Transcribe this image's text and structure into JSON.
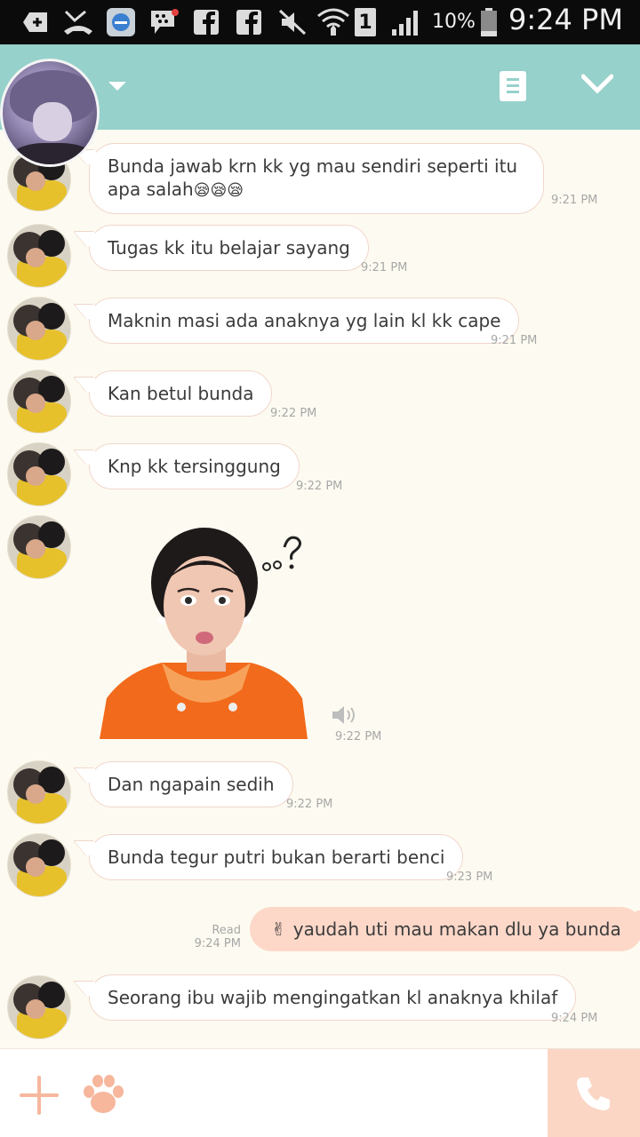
{
  "status_bar": {
    "battery_percent": "10%",
    "time": "9:24 PM",
    "sim_slot": "1",
    "icons": [
      "add-box-icon",
      "missed-call-icon",
      "app-icon",
      "bbm-icon",
      "facebook-icon",
      "facebook-icon",
      "mute-icon",
      "wifi-icon",
      "signal-icon",
      "battery-icon"
    ]
  },
  "header": {
    "background": "#96d1cb",
    "icons": [
      "dropdown-caret-icon",
      "notes-icon",
      "chevron-down-icon"
    ]
  },
  "messages": [
    {
      "type": "received",
      "text": "Bunda jawab krn kk yg mau sendiri seperti itu apa salah",
      "emoji": "😪😪😪",
      "time": "9:21 PM"
    },
    {
      "type": "received",
      "text": "Tugas kk itu belajar sayang",
      "time": "9:21 PM"
    },
    {
      "type": "received",
      "text": "Maknin masi ada anaknya yg lain kl kk cape",
      "time": "9:21 PM"
    },
    {
      "type": "received",
      "text": "Kan betul bunda",
      "time": "9:22 PM"
    },
    {
      "type": "received",
      "text": "Knp kk tersinggung",
      "time": "9:22 PM"
    },
    {
      "type": "sticker",
      "time": "9:22 PM"
    },
    {
      "type": "received",
      "text": "Dan ngapain sedih",
      "time": "9:22 PM"
    },
    {
      "type": "received",
      "text": "Bunda tegur putri bukan berarti benci",
      "time": "9:23 PM"
    },
    {
      "type": "sent",
      "emoji": "✌",
      "text": "yaudah uti mau makan dlu ya bunda",
      "read": "Read",
      "time": "9:24 PM"
    },
    {
      "type": "received",
      "text": "Seorang ibu wajib mengingatkan kl anaknya khilaf",
      "time": "9:24 PM"
    }
  ],
  "input_bar": {
    "placeholder": "",
    "accent": "#fcd6c5",
    "icons": [
      "plus-icon",
      "paw-icon",
      "phone-icon"
    ]
  }
}
